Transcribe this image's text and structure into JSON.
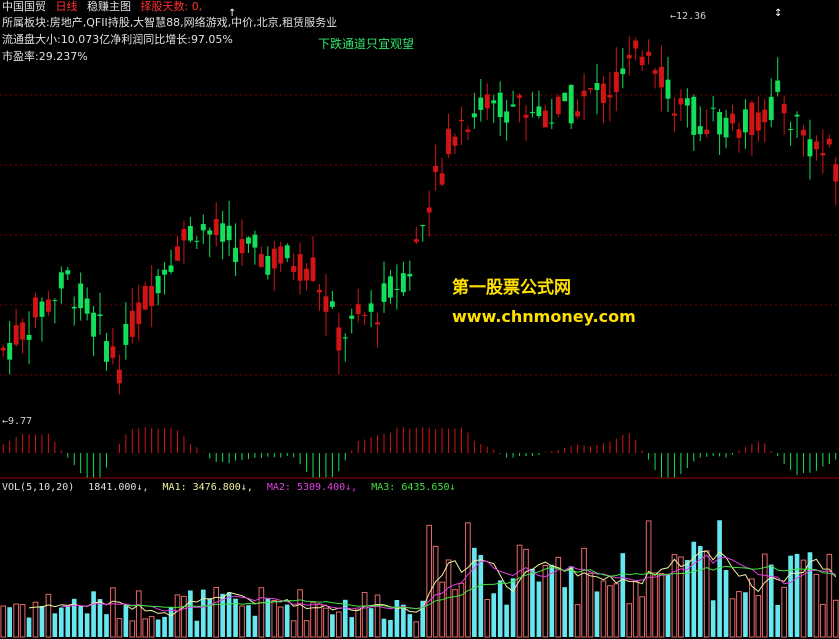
{
  "header": {
    "stock_name": "中国国贸",
    "period": "日线",
    "indicator_name": "稳赚主图",
    "pick_days": "择股天数: 0,",
    "sector_label": "所属板块:",
    "sectors": "房地产,QFII持股,大智慧88,网络游戏,中价,北京,租赁服务业",
    "float_label": "流通盘大小:",
    "float_value": "10.073亿",
    "profit_label": "净利润同比增长:",
    "profit_value": "97.05%",
    "pe_label": "市盈率:",
    "pe_value": "29.237%"
  },
  "note": "下跌通道只宜观望",
  "watermark": {
    "line1": "第一股票公式网",
    "line2": "www.chnmoney.com"
  },
  "price_labels": {
    "high": "12.36",
    "low": "9.77"
  },
  "volume_header": {
    "name": "VOL(5,10,20)",
    "vol": "1841.000↓,",
    "ma1": "MA1: 3476.800↓,",
    "ma2": "MA2: 5309.400↓,",
    "ma3": "MA3: 6435.650↓"
  },
  "colors": {
    "up": "#d21414",
    "down": "#12e05a",
    "vol_up": "#e66a6a",
    "vol_down": "#66e6ee",
    "ma1": "#f0f0a0",
    "ma2": "#e040e0",
    "ma3": "#40e040",
    "grid": "#7a0000"
  },
  "chart_data": {
    "type": "candlestick",
    "price_range": [
      9.6,
      12.5
    ],
    "high_value": 12.36,
    "low_value": 9.77,
    "volume_range": [
      0,
      14000
    ],
    "candle_count": 130,
    "series": [
      {
        "name": "VOL",
        "last": 1841.0
      },
      {
        "name": "MA1",
        "last": 3476.8
      },
      {
        "name": "MA2",
        "last": 5309.4
      },
      {
        "name": "MA3",
        "last": 6435.65
      }
    ]
  }
}
